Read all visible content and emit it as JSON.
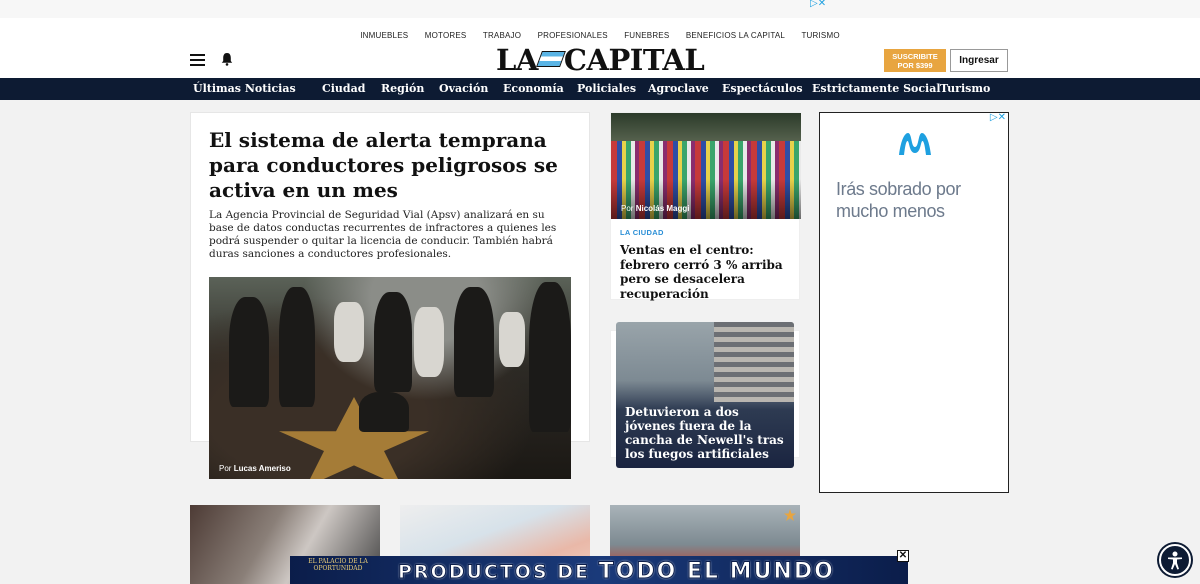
{
  "top_ad": {
    "choice_label": "▷✕"
  },
  "header": {
    "classifieds": [
      "INMUEBLES",
      "MOTORES",
      "TRABAJO",
      "PROFESIONALES",
      "FUNEBRES",
      "BENEFICIOS LA CAPITAL",
      "TURISMO"
    ],
    "logo_left": "LA",
    "logo_right": "CAPITAL",
    "subscribe_line1": "SUSCRIBITE",
    "subscribe_line2": "POR $399",
    "login_label": "Ingresar"
  },
  "nav": {
    "items": [
      "Últimas Noticias",
      "Ciudad",
      "Región",
      "Ovación",
      "Economía",
      "Policiales",
      "Agroclave",
      "Espectáculos",
      "Estrictamente Social",
      "Turismo"
    ]
  },
  "main_story": {
    "title": "El sistema de alerta temprana para conductores peligrosos se activa en un mes",
    "summary": "La Agencia Provincial de Seguridad Vial (Apsv) analizará en su base de datos conductas recurrentes de infractores a quienes les podrá suspender o quitar la licencia de conducir. También habrá duras sanciones a conductores profesionales.",
    "credit_prefix": "Por",
    "credit_name": "Lucas Ameriso"
  },
  "side_story_1": {
    "credit_prefix": "Por",
    "credit_name": "Nicolás Maggi",
    "section": "LA CIUDAD",
    "title": "Ventas en el centro: febrero cerró 3 % arriba pero se desacelera recuperación"
  },
  "side_story_2": {
    "title": "Detuvieron a dos jóvenes fuera de la cancha de Newell's tras los fuegos artificiales"
  },
  "right_ad": {
    "choice_label": "▷✕",
    "text": "Irás sobrado por mucho menos",
    "brand_color": "#1ea0e0"
  },
  "bottom_ad": {
    "brand": "EL PALACIO DE LA OPORTUNIDAD",
    "slogan_small": "PRODUCTOS DE",
    "slogan_big": "TODO EL MUNDO",
    "close_label": "✕"
  },
  "colors": {
    "nav_bg": "#0d1b33",
    "accent_orange": "#e8a540",
    "section_blue": "#2b8fd6"
  }
}
